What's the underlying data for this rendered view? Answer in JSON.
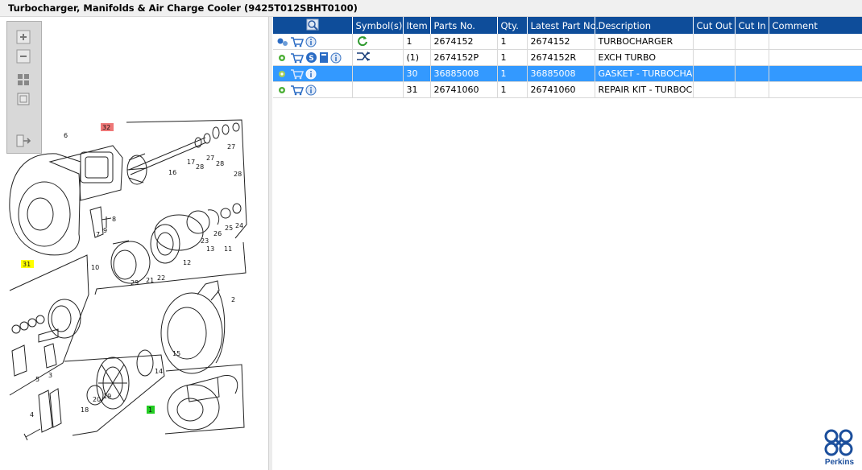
{
  "window": {
    "title": "Turbocharger, Manifolds & Air Charge Cooler (9425T012SBHT0100)"
  },
  "toolbar": {
    "buttons": [
      "zoom-in",
      "zoom-out",
      "fit-to-window",
      "actual-size",
      "export"
    ]
  },
  "diagram": {
    "callouts": [
      "6",
      "32",
      "16",
      "17",
      "27",
      "28",
      "28",
      "27",
      "28",
      "31",
      "9",
      "7",
      "8",
      "10",
      "29",
      "21",
      "22",
      "12",
      "13",
      "11",
      "23",
      "26",
      "25",
      "24",
      "2",
      "15",
      "14",
      "19",
      "20",
      "18",
      "5",
      "3",
      "4",
      "1"
    ],
    "highlight_callouts": {
      "red": "32",
      "yellow": "31",
      "green": "1"
    }
  },
  "table": {
    "columns": [
      "",
      "Symbol(s)",
      "Item",
      "Parts No.",
      "Qty.",
      "Latest Part No.",
      "Description",
      "Cut Out",
      "Cut In",
      "Comment"
    ],
    "rows": [
      {
        "item": "1",
        "parts_no": "2674152",
        "qty": "1",
        "latest": "2674152",
        "desc": "TURBOCHARGER",
        "cut_out": "",
        "cut_in": "",
        "comment": "",
        "selected": false
      },
      {
        "item": "(1)",
        "parts_no": "2674152P",
        "qty": "1",
        "latest": "2674152R",
        "desc": "EXCH TURBO",
        "cut_out": "",
        "cut_in": "",
        "comment": "",
        "selected": false
      },
      {
        "item": "30",
        "parts_no": "36885008",
        "qty": "1",
        "latest": "36885008",
        "desc": "GASKET - TURBOCHARG",
        "cut_out": "",
        "cut_in": "",
        "comment": "",
        "selected": true
      },
      {
        "item": "31",
        "parts_no": "26741060",
        "qty": "1",
        "latest": "26741060",
        "desc": "REPAIR KIT - TURBOCHA",
        "cut_out": "",
        "cut_in": "",
        "comment": "",
        "selected": false
      }
    ]
  },
  "brand": {
    "name": "Perkins",
    "color": "#1c4f9c"
  },
  "colors": {
    "header": "#0e4d9a",
    "selected": "#3399ff"
  }
}
